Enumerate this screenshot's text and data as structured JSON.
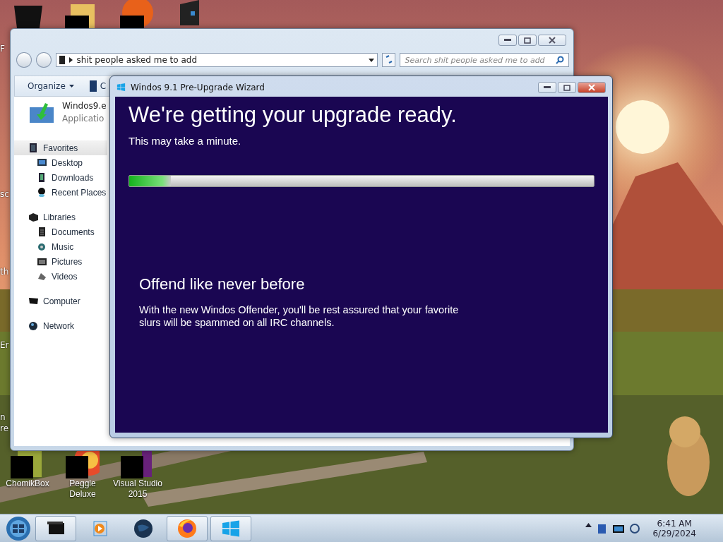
{
  "desktop": {
    "partial_labels": [
      "F",
      "sc",
      "th",
      "Er",
      "n",
      "re"
    ],
    "icons": [
      {
        "kind": "chomik",
        "label": "ChomikBox"
      },
      {
        "kind": "peggle",
        "label": "Peggle Deluxe"
      },
      {
        "kind": "vs",
        "label": "Visual Studio 2015"
      }
    ]
  },
  "explorer": {
    "address": "shit people asked me to add",
    "search": {
      "placeholder": "Search shit people asked me to add"
    },
    "toolbar": [
      "Organize",
      "C"
    ],
    "nav": [
      {
        "label": "Favorites",
        "kind": "star",
        "selected": true,
        "children": [
          {
            "label": "Desktop",
            "kind": "desktop",
            "selected": false
          },
          {
            "label": "Downloads",
            "kind": "downloads",
            "selected": false
          },
          {
            "label": "Recent Places",
            "kind": "recent",
            "selected": false
          }
        ]
      },
      {
        "label": "Libraries",
        "kind": "library",
        "selected": false,
        "children": [
          {
            "label": "Documents",
            "kind": "documents",
            "selected": false
          },
          {
            "label": "Music",
            "kind": "music",
            "selected": false
          },
          {
            "label": "Pictures",
            "kind": "pictures",
            "selected": false
          },
          {
            "label": "Videos",
            "kind": "videos",
            "selected": false
          }
        ]
      },
      {
        "label": "Computer",
        "kind": "computer",
        "selected": false
      },
      {
        "label": "Network",
        "kind": "network",
        "selected": false
      }
    ],
    "file": {
      "name": "Windos9.e",
      "type": "Applicatio"
    }
  },
  "wizard": {
    "title": "Windos 9.1 Pre-Upgrade Wizard",
    "heading": "We're getting your upgrade ready.",
    "subtitle": "This may take a minute.",
    "progress": {
      "level": 0.09
    },
    "feature_title": "Offend like never before",
    "feature_text": "With the new Windos Offender, you'll be rest assured that your favorite slurs will be spammed on all IRC channels."
  },
  "taskbar": {
    "buttons": [
      {
        "kind": "explorer",
        "active": true
      },
      {
        "kind": "media",
        "active": false
      },
      {
        "kind": "globe",
        "active": false
      },
      {
        "kind": "firefox",
        "active": true
      },
      {
        "kind": "windows",
        "active": true
      }
    ],
    "time": "6:41 AM",
    "date": "6/29/2024"
  }
}
